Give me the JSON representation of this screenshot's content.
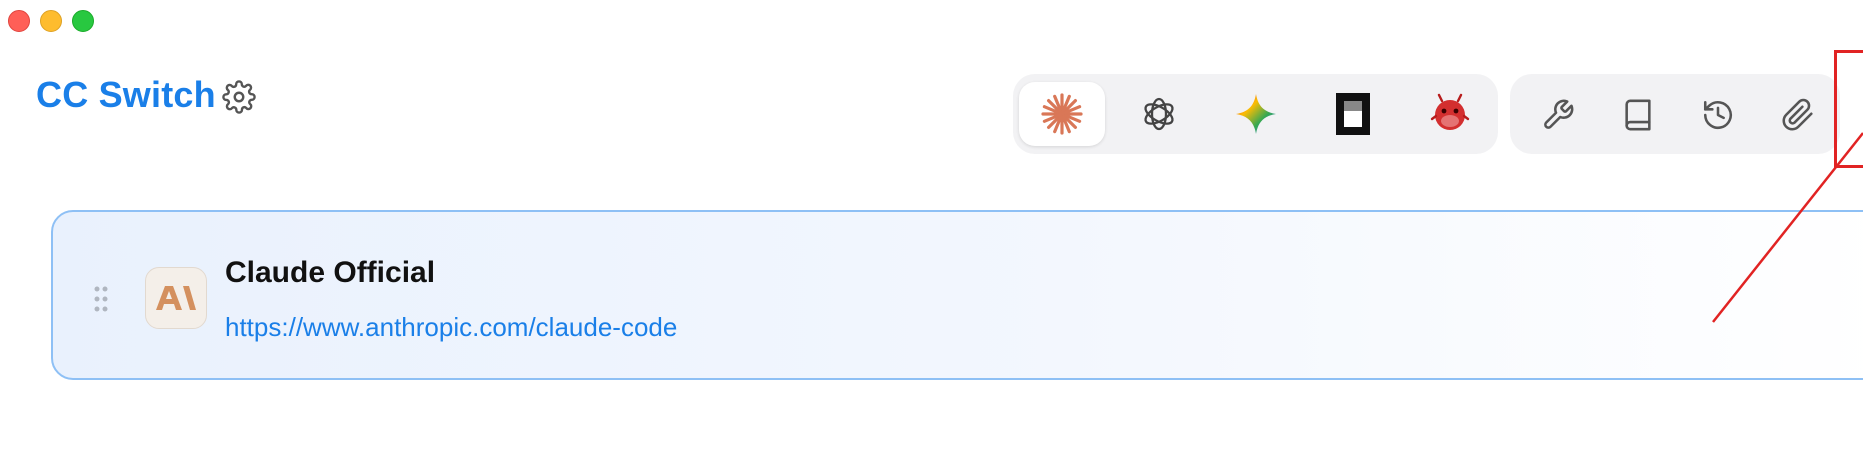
{
  "window": {
    "title": "CC Switch"
  },
  "header": {
    "settings_icon": "gear-icon"
  },
  "app_switcher": {
    "tabs": [
      {
        "id": "claude",
        "icon": "claude-starburst-icon",
        "active": true,
        "color": "#d97757"
      },
      {
        "id": "codex",
        "icon": "openai-icon",
        "active": false
      },
      {
        "id": "gemini",
        "icon": "gemini-sparkle-icon",
        "active": false
      },
      {
        "id": "opencode",
        "icon": "opencode-icon",
        "active": false
      },
      {
        "id": "other",
        "icon": "red-mascot-icon",
        "active": false
      }
    ]
  },
  "toolbar": {
    "items": [
      {
        "icon": "wrench-icon"
      },
      {
        "icon": "book-icon"
      },
      {
        "icon": "history-icon"
      },
      {
        "icon": "paperclip-icon"
      }
    ]
  },
  "provider": {
    "name": "Claude Official",
    "url": "https://www.anthropic.com/claude-code",
    "logo_icon": "anthropic-logo-icon",
    "logo_color": "#d4905e"
  },
  "colors": {
    "accent": "#1a7fe8",
    "card_border": "#8ec0f5",
    "annotation": "#e12323"
  }
}
